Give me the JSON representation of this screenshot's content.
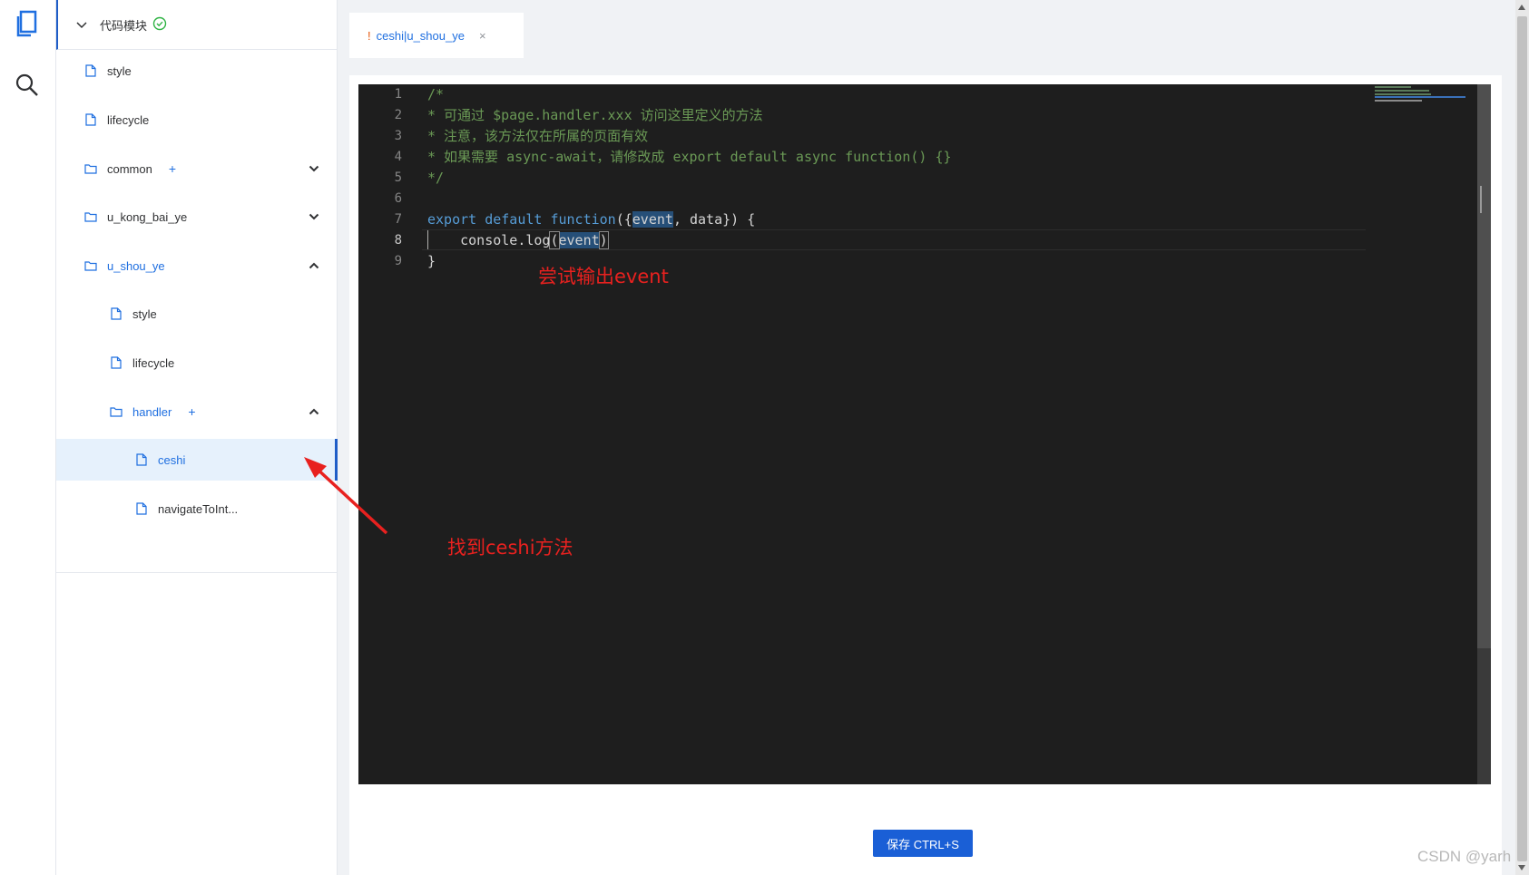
{
  "sidebar": {
    "header_title": "代码模块",
    "items": [
      {
        "label": "style",
        "type": "file"
      },
      {
        "label": "lifecycle",
        "type": "file"
      },
      {
        "label": "common",
        "type": "folder",
        "plus": "+"
      },
      {
        "label": "u_kong_bai_ye",
        "type": "folder"
      },
      {
        "label": "u_shou_ye",
        "type": "folder"
      },
      {
        "label": "style",
        "type": "file"
      },
      {
        "label": "lifecycle",
        "type": "file"
      },
      {
        "label": "handler",
        "type": "folder",
        "plus": "+"
      },
      {
        "label": "ceshi",
        "type": "file",
        "active": true
      },
      {
        "label": "navigateToInt...",
        "type": "file"
      }
    ]
  },
  "tab": {
    "modified_mark": "!",
    "label": "ceshi|u_shou_ye",
    "close": "×"
  },
  "editor": {
    "line_numbers": [
      "1",
      "2",
      "3",
      "4",
      "5",
      "6",
      "7",
      "8",
      "9"
    ],
    "current_line": 8,
    "lines": {
      "l1": "/*",
      "l2": "* 可通过 $page.handler.xxx 访问这里定义的方法",
      "l3": "* 注意，该方法仅在所属的页面有效",
      "l4": "* 如果需要 async-await，请修改成 export default async function() {}",
      "l5": "*/",
      "l7_kw1": "export",
      "l7_kw2": "default",
      "l7_kw3": "function",
      "l7_p1": "({",
      "l7_event": "event",
      "l7_p2": ", data}) {",
      "l8_indent": "    ",
      "l8_fn": "console.log",
      "l8_open": "(",
      "l8_arg": "event",
      "l8_close": ")",
      "l9": "}"
    }
  },
  "annotations": {
    "output_event": "尝试输出event",
    "find_method": "找到ceshi方法",
    "color": "#e8211f"
  },
  "save_button": "保存 CTRL+S",
  "watermark": "CSDN @yarh",
  "colors": {
    "accent": "#1f6fe0",
    "editor_bg": "#1e1e1e",
    "comment": "#6a9955",
    "keyword": "#569cd6"
  }
}
